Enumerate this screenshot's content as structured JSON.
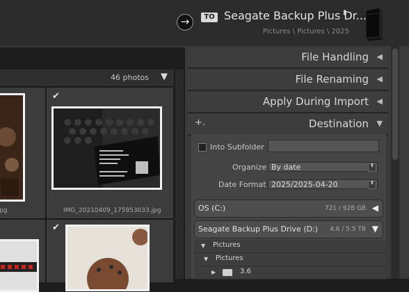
{
  "header": {
    "to_badge": "TO",
    "destination_name": "Seagate Backup Plus Dr...",
    "destination_chevron": "⬍",
    "destination_path": "Pictures \\ Pictures \\ 2025",
    "arrow_icon": "→"
  },
  "grid": {
    "photo_count": "46 photos",
    "count_chevron": "▼",
    "cells": [
      {
        "filename": "pg"
      },
      {
        "filename": "IMG_20210409_175953033.jpg",
        "checked": true
      },
      {
        "filename": ""
      },
      {
        "filename": "",
        "checked": true
      }
    ],
    "checkmark": "✔"
  },
  "panel": {
    "sections": [
      {
        "title": "File Handling",
        "chevron": "◀"
      },
      {
        "title": "File Renaming",
        "chevron": "◀"
      },
      {
        "title": "Apply During Import",
        "chevron": "◀"
      },
      {
        "title": "Destination",
        "chevron": "▼"
      }
    ],
    "plus_icon": "+.",
    "into_subfolder_label": "Into Subfolder",
    "organize_label": "Organize",
    "organize_value": "By date",
    "date_format_label": "Date Format",
    "date_format_value": "2025/2025-04-20",
    "spinner": "⬍",
    "drives": [
      {
        "name": "OS (C:)",
        "size": "721 / 928 GB",
        "chevron": "◀"
      },
      {
        "name": "Seagate Backup Plus Drive (D:)",
        "size": "4.6 / 5.5 TB",
        "chevron": "▼"
      }
    ],
    "tree": [
      {
        "name": "Pictures",
        "tri": "▼"
      },
      {
        "name": "Pictures",
        "tri": "▼"
      },
      {
        "name": "3.6",
        "tri": "▶"
      }
    ]
  }
}
